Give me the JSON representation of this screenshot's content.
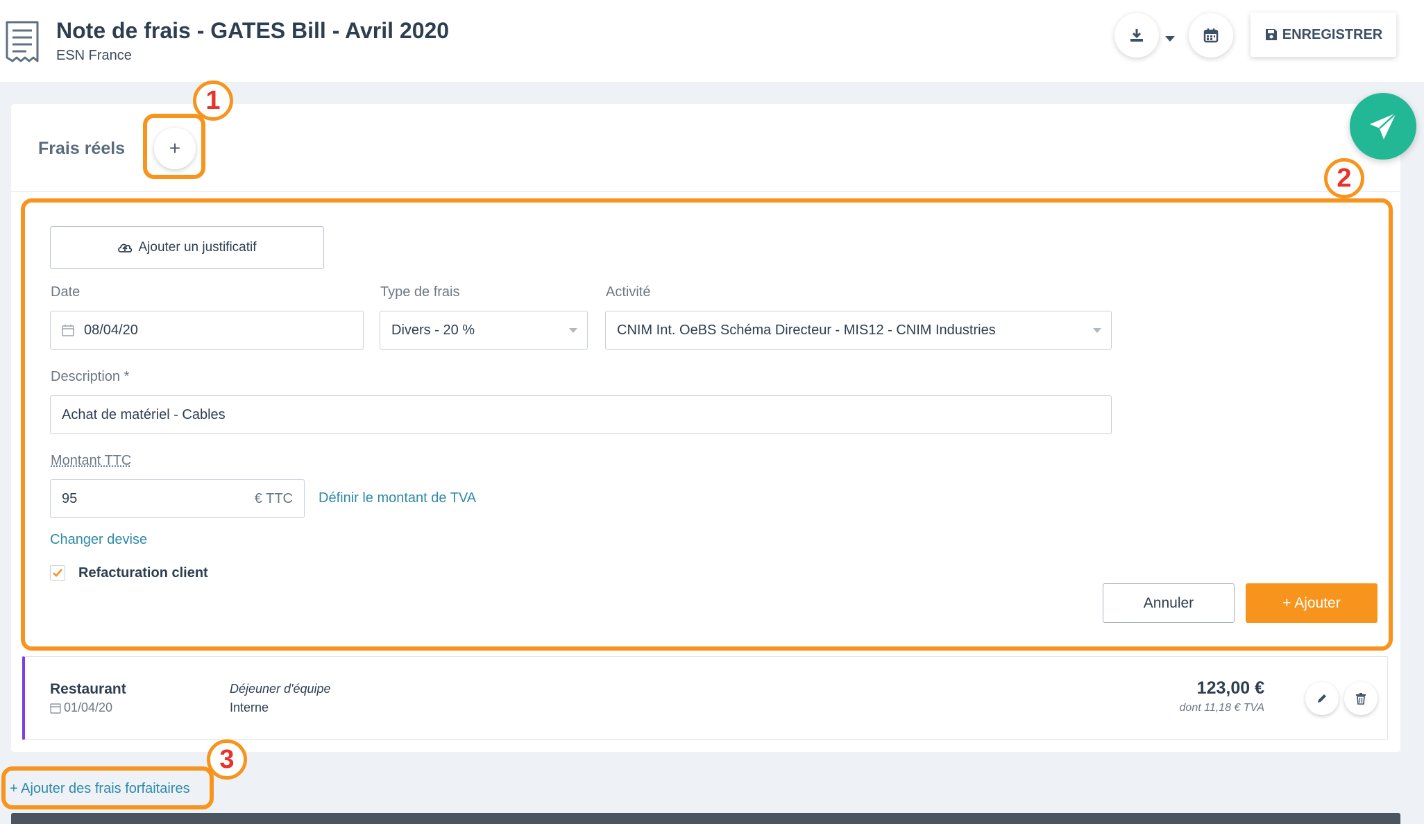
{
  "header": {
    "title": "Note de frais - GATES Bill - Avril 2020",
    "subtitle": "ESN France",
    "doc_icon": "receipt-icon",
    "download_icon": "download-icon",
    "calendar_icon": "calendar-icon",
    "save_label": "ENREGISTRER",
    "save_icon": "floppy-disk-icon"
  },
  "section": {
    "title": "Frais réels",
    "add_symbol": "+"
  },
  "send_icon": "paper-plane-icon",
  "form": {
    "upload_label": "Ajouter un justificatif",
    "upload_icon": "cloud-upload-icon",
    "date_label": "Date",
    "date_value": "08/04/20",
    "type_label": "Type de frais",
    "type_value": "Divers - 20 %",
    "activity_label": "Activité",
    "activity_value": "CNIM Int. OeBS Schéma Directeur - MIS12 - CNIM Industries",
    "description_label": "Description *",
    "description_value": "Achat de matériel - Cables",
    "amount_label": "Montant TTC",
    "amount_value": "95",
    "amount_unit": "€  TTC",
    "tva_link": "Définir le montant de TVA",
    "currency_link": "Changer devise",
    "refacturation_label": "Refacturation client",
    "refacturation_checked": true,
    "cancel_label": "Annuler",
    "add_label": "+ Ajouter"
  },
  "expenses": [
    {
      "category": "Restaurant",
      "date": "01/04/20",
      "description": "Déjeuner d'équipe",
      "activity": "Interne",
      "amount": "123,00 €",
      "tva": "dont 11,18 € TVA",
      "accent_color": "#7b3fe4"
    }
  ],
  "forfait_link": "+ Ajouter des frais forfaitaires",
  "annotations": [
    "1",
    "2",
    "3"
  ],
  "colors": {
    "accent": "#f7941d",
    "link": "#2e8aa6",
    "fab": "#22b795",
    "annotation_number": "#e8322b"
  }
}
